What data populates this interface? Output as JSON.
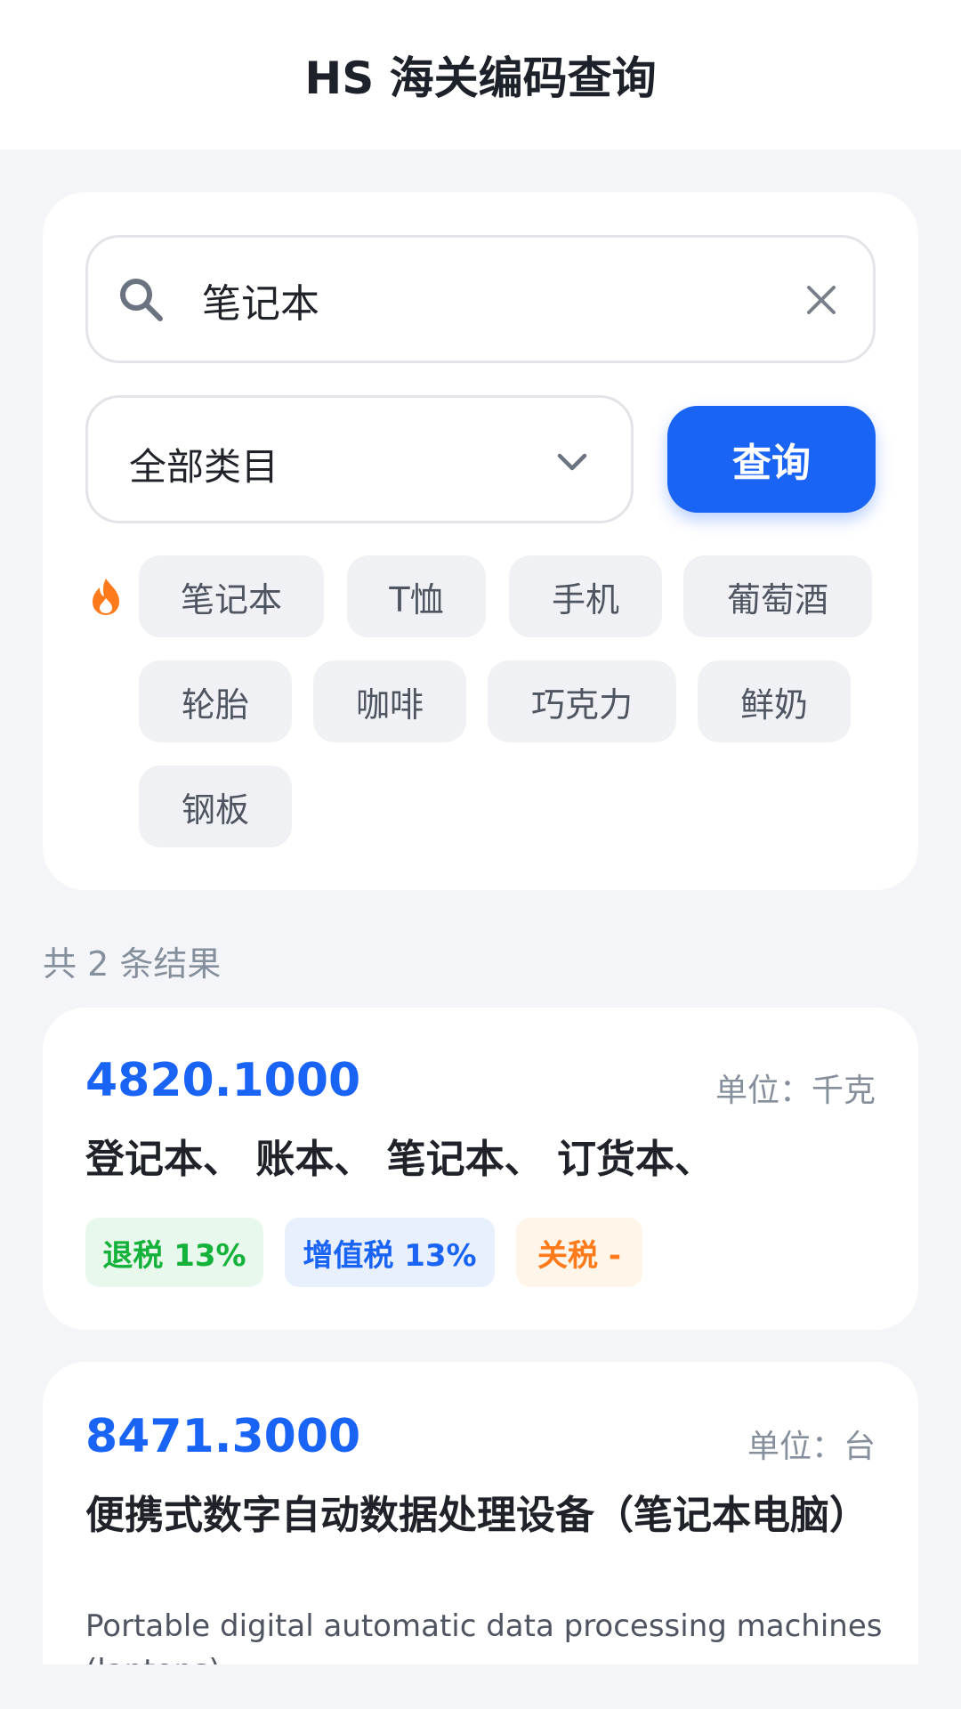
{
  "header": {
    "title": "HS 海关编码查询"
  },
  "search": {
    "value": "笔记本",
    "placeholder": ""
  },
  "category": {
    "selected": "全部类目"
  },
  "query_button": {
    "label": "查询"
  },
  "hot_tags": [
    "笔记本",
    "T恤",
    "手机",
    "葡萄酒",
    "轮胎",
    "咖啡",
    "巧克力",
    "鲜奶",
    "钢板"
  ],
  "results_summary": "共 2 条结果",
  "results": [
    {
      "code": "4820.1000",
      "unit": "单位：千克",
      "name": "登记本、 账本、 笔记本、 订货本、",
      "badges": {
        "refund": "退税 13%",
        "vat": "增值税 13%",
        "tariff": "关税 -"
      }
    },
    {
      "code": "8471.3000",
      "unit": "单位：台",
      "name": "便携式数字自动数据处理设备（笔记本电脑）",
      "name_en": "Portable digital automatic data processing machines (laptops)"
    }
  ],
  "colors": {
    "primary": "#1964f5",
    "hot": "#ff7a1a",
    "refund": "#14b23a",
    "tariff": "#ff7a1a"
  }
}
